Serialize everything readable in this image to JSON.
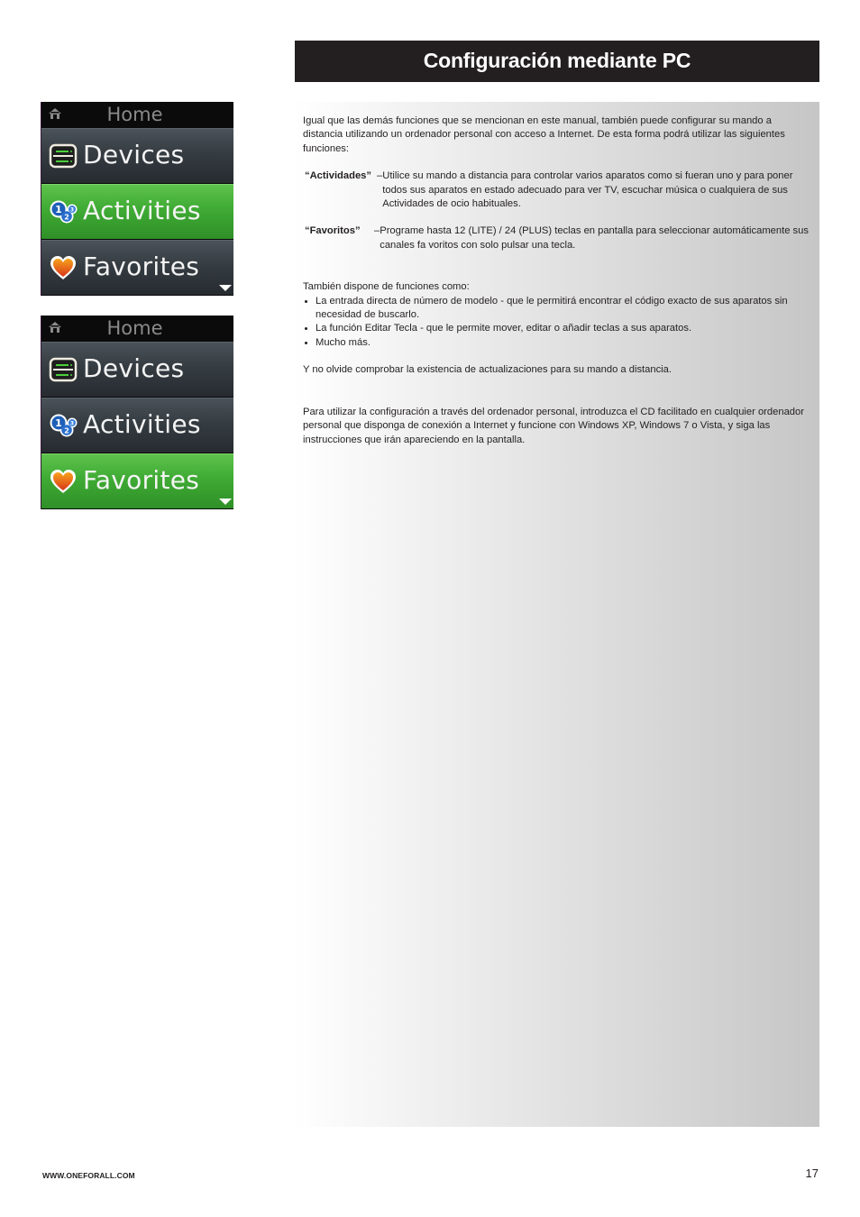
{
  "screens": [
    {
      "header": {
        "icon": "home-icon",
        "title": "Home"
      },
      "items": [
        {
          "icon": "devices-icon",
          "label": "Devices",
          "selected": false
        },
        {
          "icon": "activities-icon",
          "label": "Activities",
          "selected": true
        },
        {
          "icon": "favorites-heart-icon",
          "label": "Favorites",
          "selected": false
        }
      ],
      "scroll_indicator": "chevron-down-icon"
    },
    {
      "header": {
        "icon": "home-icon",
        "title": "Home"
      },
      "items": [
        {
          "icon": "devices-icon",
          "label": "Devices",
          "selected": false
        },
        {
          "icon": "activities-icon",
          "label": "Activities",
          "selected": false
        },
        {
          "icon": "favorites-heart-icon",
          "label": "Favorites",
          "selected": true
        }
      ],
      "scroll_indicator": "chevron-down-icon"
    }
  ],
  "colors": {
    "selected_item": "#3fab34",
    "unselected_item": "#353c42",
    "title_bar": "#231f20"
  },
  "section": {
    "title": "Configuración mediante PC",
    "intro": "Igual que las demás funciones que se mencionan en este manual, también puede configurar su mando a distancia utilizando un ordenador personal con acceso a Internet. De esta forma podrá utilizar las siguientes funciones:",
    "definitions": [
      {
        "term": "“Actividades”",
        "dash": " – ",
        "description": "Utilice su mando a distancia para controlar varios aparatos como si fueran uno y para poner todos sus aparatos en estado adecuado para ver TV, escuchar música o cualquiera de sus Actividades de ocio habituales."
      },
      {
        "term": "“Favoritos”",
        "dash": " – ",
        "description": "Programe hasta 12 (LITE) / 24 (PLUS) teclas en pantalla para seleccionar automáticamente sus canales fa voritos con solo pulsar una tecla."
      }
    ],
    "features_intro": "También dispone de funciones como:",
    "features": [
      "La entrada directa de número de modelo - que le permitirá encontrar el código exacto de sus aparatos sin necesidad de buscarlo.",
      "La función Editar Tecla - que le permite mover, editar o añadir teclas a sus aparatos.",
      "Mucho más."
    ],
    "reminder": "Y no olvide comprobar la existencia de actualizaciones para su mando a distancia.",
    "instructions": "Para utilizar la configuración a través del ordenador personal, introduzca el CD facilitado en cualquier ordenador personal que disponga de conexión a Internet y funcione con Windows XP, Windows 7 o Vista, y siga las instrucciones que irán apareciendo en la pantalla."
  },
  "footer": {
    "url": "WWW.ONEFORALL.COM",
    "page_number": "17"
  }
}
